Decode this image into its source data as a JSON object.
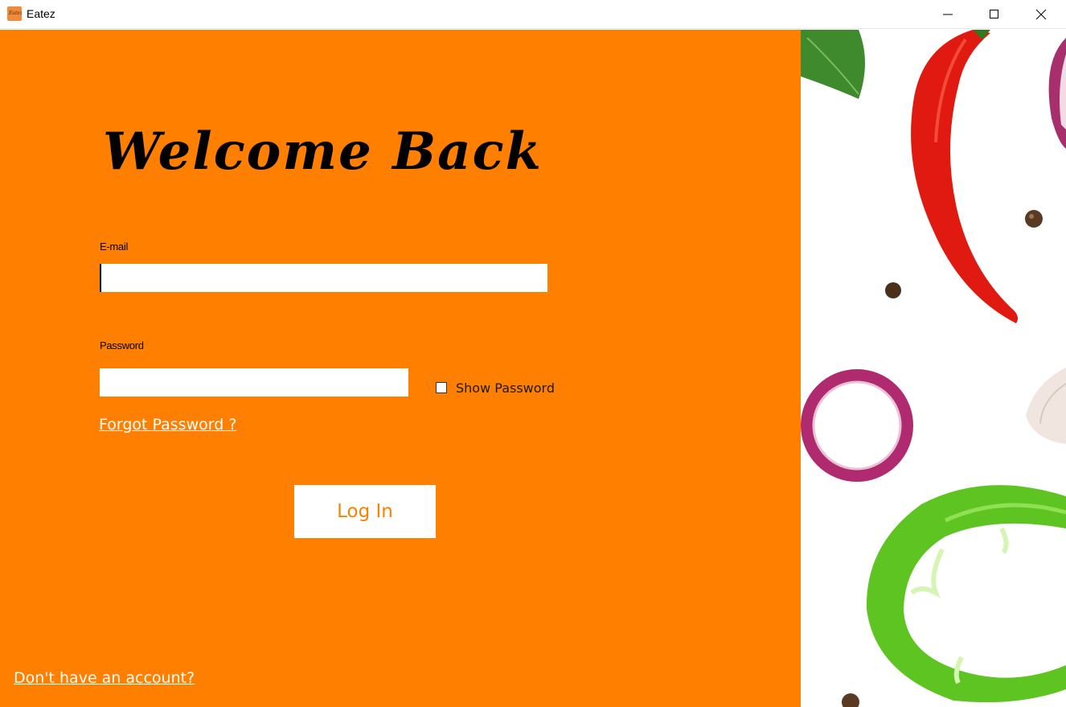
{
  "window": {
    "title": "Eatez",
    "icon": "eatez-app-icon"
  },
  "login": {
    "heading": "Welcome Back",
    "email_label": "E-mail",
    "email_value": "",
    "password_label": "Password",
    "password_value": "",
    "show_password_label": "Show Password",
    "show_password_checked": false,
    "forgot_password": "Forgot Password ?",
    "login_button": "Log In",
    "signup_link": "Don't have an account?"
  },
  "colors": {
    "panel": "#ff7f00",
    "button_text": "#ff7f00",
    "link_text": "#ffffff"
  }
}
